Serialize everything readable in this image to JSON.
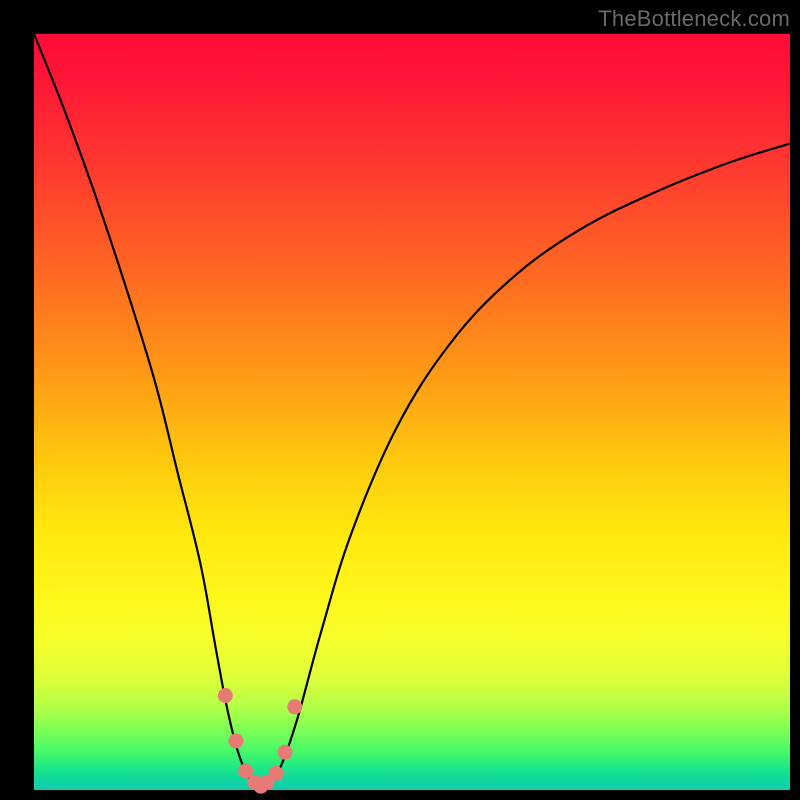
{
  "watermark": "TheBottleneck.com",
  "colors": {
    "frame": "#000000",
    "gradient_top": "#ff0a3a",
    "gradient_bottom": "#12cbb0",
    "curve": "#000000",
    "markers": "#e77a74"
  },
  "chart_data": {
    "type": "line",
    "title": "",
    "xlabel": "",
    "ylabel": "",
    "xlim": [
      0,
      100
    ],
    "ylim": [
      0,
      100
    ],
    "series": [
      {
        "name": "bottleneck-curve",
        "x": [
          0,
          4,
          8,
          12,
          16,
          19,
          22,
          24,
          25.5,
          27,
          28.5,
          30,
          31.5,
          33,
          35,
          38,
          42,
          48,
          55,
          63,
          72,
          82,
          92,
          100
        ],
        "y": [
          100,
          90,
          79,
          67,
          54,
          42,
          30,
          19,
          11,
          5,
          1.5,
          0.5,
          1.2,
          4,
          10,
          21,
          34,
          48,
          59,
          67.5,
          74,
          79,
          83,
          85.5
        ]
      }
    ],
    "markers": {
      "name": "highlight-points",
      "x": [
        25.3,
        26.7,
        28.0,
        29.2,
        30.0,
        30.8,
        32.0,
        33.2,
        34.5
      ],
      "y": [
        12.5,
        6.5,
        2.5,
        1.0,
        0.5,
        1.0,
        2.2,
        5.0,
        11.0
      ]
    }
  }
}
